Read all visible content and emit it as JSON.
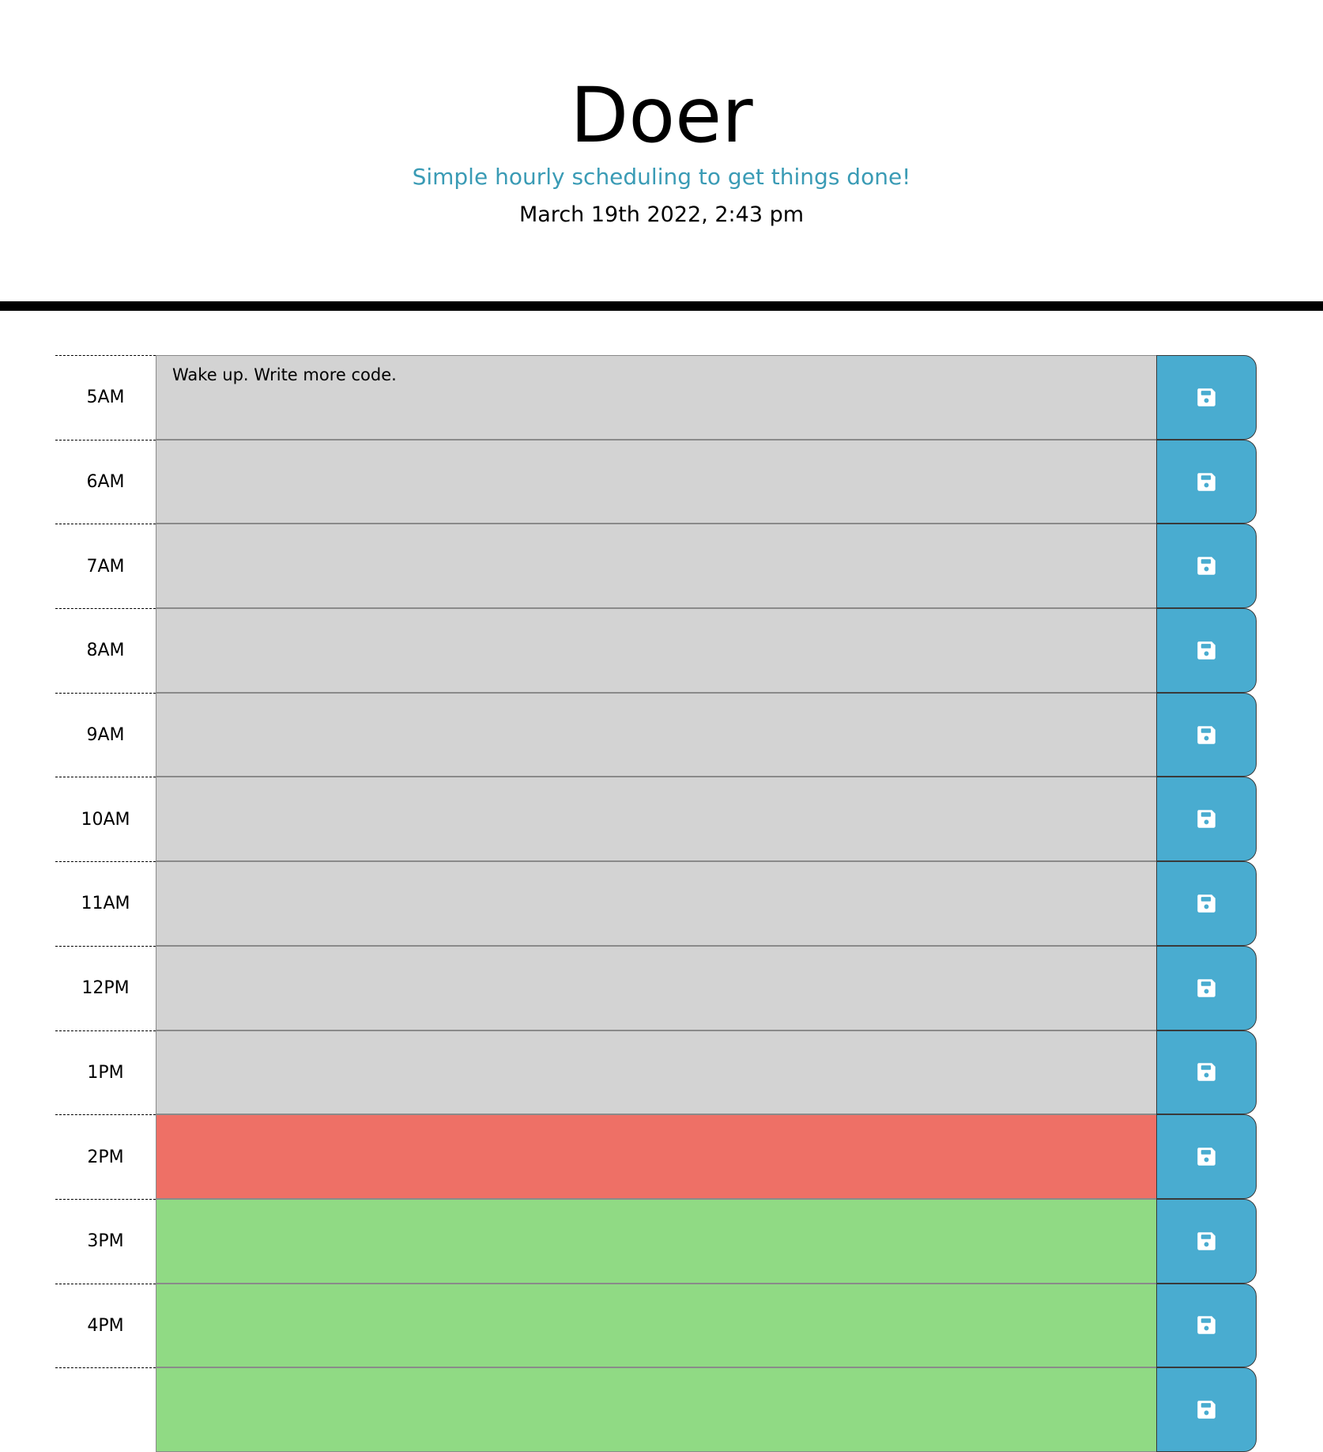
{
  "header": {
    "title": "Doer",
    "tagline": "Simple hourly scheduling to get things done!",
    "datetime": "March 19th 2022, 2:43 pm"
  },
  "colors": {
    "past": "#d3d3d3",
    "present": "#ee7066",
    "future": "#90da84",
    "save_button": "#49acd0",
    "tagline": "#3a9bb5"
  },
  "timeblocks": [
    {
      "hour": "5AM",
      "text": "Wake up. Write more code.",
      "state": "past",
      "icon": "save-icon"
    },
    {
      "hour": "6AM",
      "text": "",
      "state": "past",
      "icon": "save-icon"
    },
    {
      "hour": "7AM",
      "text": "",
      "state": "past",
      "icon": "save-icon"
    },
    {
      "hour": "8AM",
      "text": "",
      "state": "past",
      "icon": "save-icon"
    },
    {
      "hour": "9AM",
      "text": "",
      "state": "past",
      "icon": "save-icon"
    },
    {
      "hour": "10AM",
      "text": "",
      "state": "past",
      "icon": "save-icon"
    },
    {
      "hour": "11AM",
      "text": "",
      "state": "past",
      "icon": "save-icon"
    },
    {
      "hour": "12PM",
      "text": "",
      "state": "past",
      "icon": "save-icon"
    },
    {
      "hour": "1PM",
      "text": "",
      "state": "past",
      "icon": "save-icon"
    },
    {
      "hour": "2PM",
      "text": "",
      "state": "present",
      "icon": "save-icon"
    },
    {
      "hour": "3PM",
      "text": "",
      "state": "future",
      "icon": "save-icon"
    },
    {
      "hour": "4PM",
      "text": "",
      "state": "future",
      "icon": "save-icon"
    },
    {
      "hour": "",
      "text": "",
      "state": "future",
      "icon": "save-icon"
    }
  ]
}
